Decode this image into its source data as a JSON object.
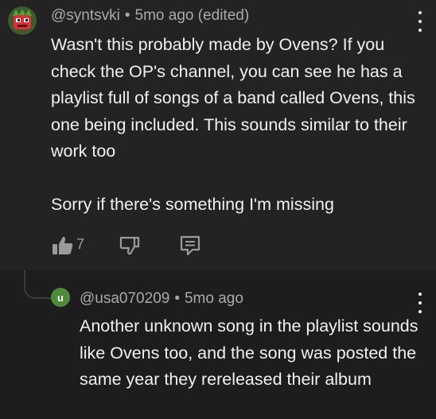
{
  "comment": {
    "author": "@syntsvki",
    "separator": "•",
    "time": "5mo ago (edited)",
    "paragraph1": "Wasn't this probably made by Ovens? If you check the OP's channel, you can see he has a playlist full of songs of a band called Ovens, this one being included. This sounds similar to their work too",
    "paragraph2": "Sorry if there's something I'm missing",
    "like_count": "7",
    "avatar_icon": "cartoon-avatar-icon"
  },
  "reply": {
    "avatar_letter": "u",
    "avatar_color": "#4f8a3a",
    "author": "@usa070209",
    "separator": "•",
    "time": "5mo ago",
    "text": "Another unknown song in the playlist sounds like Ovens too, and the song was posted the same year they rereleased their album"
  },
  "icons": {
    "like": "thumbs-up-icon",
    "dislike": "thumbs-down-icon",
    "reply": "comment-icon",
    "more": "more-vert-icon"
  }
}
